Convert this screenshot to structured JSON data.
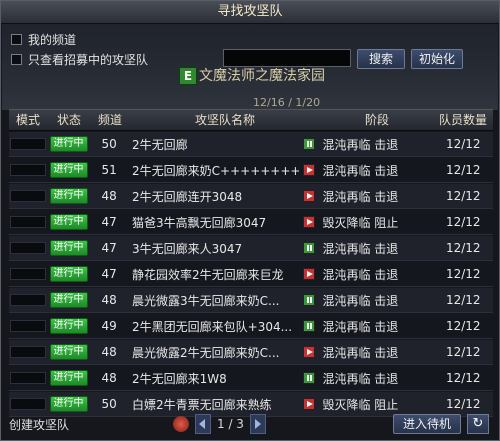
{
  "window": {
    "title": "寻找攻坚队"
  },
  "filters": {
    "my_channel": "我的频道",
    "only_recruiting": "只查看招募中的攻坚队"
  },
  "search": {
    "button": "搜索",
    "reset": "初始化"
  },
  "overlay": {
    "badge": "E",
    "title": "文魔法师之魔法家园",
    "sub": "12/16 / 1/20"
  },
  "table": {
    "headers": [
      "模式",
      "状态",
      "频道",
      "攻坚队名称",
      "阶段",
      "队员数量"
    ],
    "rows": [
      {
        "status": "进行中",
        "channel": "50",
        "name": "2牛无回廊",
        "icon": "pause",
        "stage": "混沌再临 击退",
        "count": "12/12"
      },
      {
        "status": "进行中",
        "channel": "51",
        "name": "2牛无回廊来奶C++++++++++",
        "icon": "play",
        "stage": "混沌再临 击退",
        "count": "12/12"
      },
      {
        "status": "进行中",
        "channel": "48",
        "name": "2牛无回廊连开3048",
        "icon": "play",
        "stage": "混沌再临 击退",
        "count": "12/12"
      },
      {
        "status": "进行中",
        "channel": "47",
        "name": "猫爸3牛高飘无回廊3047",
        "icon": "play",
        "stage": "毁灭降临 阻止",
        "count": "12/12"
      },
      {
        "status": "进行中",
        "channel": "47",
        "name": "3牛无回廊来人3047",
        "icon": "pause",
        "stage": "混沌再临 击退",
        "count": "12/12"
      },
      {
        "status": "进行中",
        "channel": "47",
        "name": "静花园效率2牛无回廊来巨龙",
        "icon": "play",
        "stage": "混沌再临 击退",
        "count": "12/12"
      },
      {
        "status": "进行中",
        "channel": "48",
        "name": "晨光微露3牛无回廊来奶C...",
        "icon": "pause",
        "stage": "混沌再临 击退",
        "count": "12/12"
      },
      {
        "status": "进行中",
        "channel": "49",
        "name": "2牛黑团无回廊来包队+304...",
        "icon": "pause",
        "stage": "混沌再临 击退",
        "count": "12/12"
      },
      {
        "status": "进行中",
        "channel": "48",
        "name": "晨光微露2牛无回廊来奶C...",
        "icon": "play",
        "stage": "混沌再临 击退",
        "count": "12/12"
      },
      {
        "status": "进行中",
        "channel": "48",
        "name": "2牛无回廊来1W8",
        "icon": "pause",
        "stage": "混沌再临 击退",
        "count": "12/12"
      },
      {
        "status": "进行中",
        "channel": "50",
        "name": "白嫖2牛青票无回廊来熟练",
        "icon": "play",
        "stage": "毁灭降临 阻止",
        "count": "12/12"
      }
    ]
  },
  "footer": {
    "create": "创建攻坚队",
    "page": "1 / 3",
    "enter_queue": "进入待机",
    "refresh_icon": "↻"
  },
  "colors": {
    "status_green": "#2fae38",
    "play_red": "#c93030",
    "pause_green": "#3a9a3a"
  }
}
